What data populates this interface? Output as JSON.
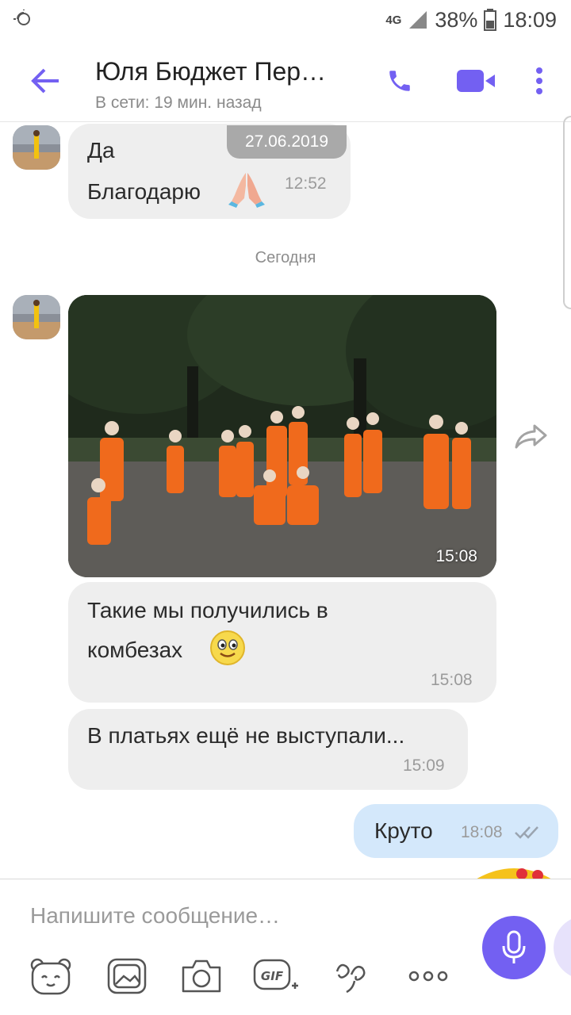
{
  "status_bar": {
    "network": "4G",
    "battery": "38%",
    "time": "18:09"
  },
  "header": {
    "contact_name": "Юля Бюджет Пер…",
    "presence": "В сети: 19 мин. назад"
  },
  "messages": {
    "date_separator": "27.06.2019",
    "msg1_line1": "Да",
    "msg1_line2": "Благодарю",
    "msg1_time": "12:52",
    "day_label": "Сегодня",
    "photo_time": "15:08",
    "msg2_line1": "Такие мы получились в",
    "msg2_line2": "комбезах",
    "msg2_time": "15:08",
    "msg3_text": "В платьях ещё не выступали...",
    "msg3_time": "15:09",
    "msg4_text": "Круто",
    "msg4_time": "18:08"
  },
  "composer": {
    "placeholder": "Напишите сообщение…"
  },
  "colors": {
    "accent": "#7360f2",
    "incoming_bubble": "#eeeeee",
    "outgoing_bubble": "#d4e8fb"
  }
}
